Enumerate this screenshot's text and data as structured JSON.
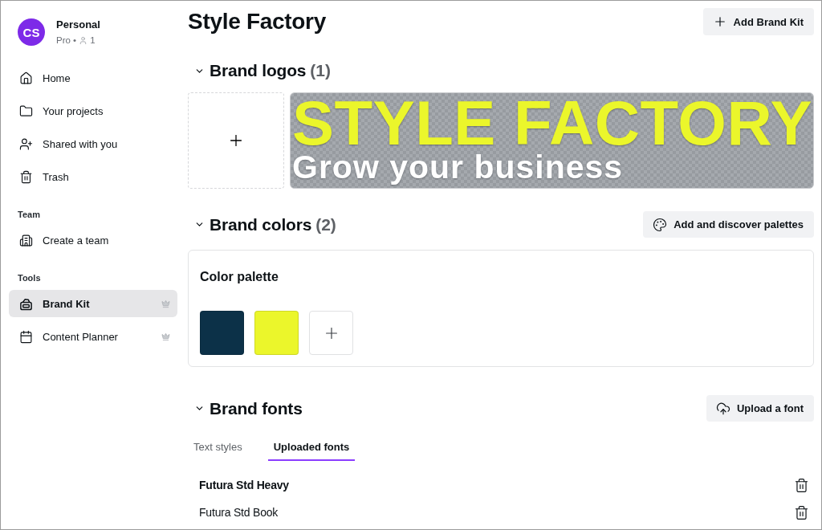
{
  "sidebar": {
    "account": {
      "initials": "CS",
      "name": "Personal",
      "plan": "Pro •",
      "members": "1"
    },
    "nav": [
      {
        "label": "Home",
        "selected": false
      },
      {
        "label": "Your projects",
        "selected": false
      },
      {
        "label": "Shared with you",
        "selected": false
      },
      {
        "label": "Trash",
        "selected": false
      }
    ],
    "sections": [
      {
        "heading": "Team",
        "items": [
          {
            "label": "Create a team",
            "selected": false
          }
        ]
      },
      {
        "heading": "Tools",
        "items": [
          {
            "label": "Brand Kit",
            "selected": true,
            "premium": true
          },
          {
            "label": "Content Planner",
            "selected": false,
            "premium": true
          }
        ]
      }
    ]
  },
  "main": {
    "title": "Style Factory",
    "add_button": "Add Brand Kit",
    "logos": {
      "title": "Brand logos",
      "count": "(1)",
      "expanded": true,
      "items": [
        {
          "name": "STYLE FACTORY",
          "tagline": "Grow your business"
        }
      ]
    },
    "colors": {
      "title": "Brand colors",
      "count": "(2)",
      "expanded": true,
      "button": "Add and discover palettes",
      "palette": {
        "title": "Color palette",
        "swatches": [
          {
            "color": "#0c3148"
          },
          {
            "color": "#ebf62b"
          }
        ]
      }
    },
    "fonts": {
      "title": "Brand fonts",
      "expanded": true,
      "button": "Upload a font",
      "tabs": [
        {
          "label": "Text styles",
          "selected": false
        },
        {
          "label": "Uploaded fonts",
          "selected": true
        }
      ],
      "items": [
        {
          "name": "Futura Std Heavy",
          "kind": "heavy"
        },
        {
          "name": "Futura Std Book",
          "kind": "book"
        }
      ]
    }
  }
}
